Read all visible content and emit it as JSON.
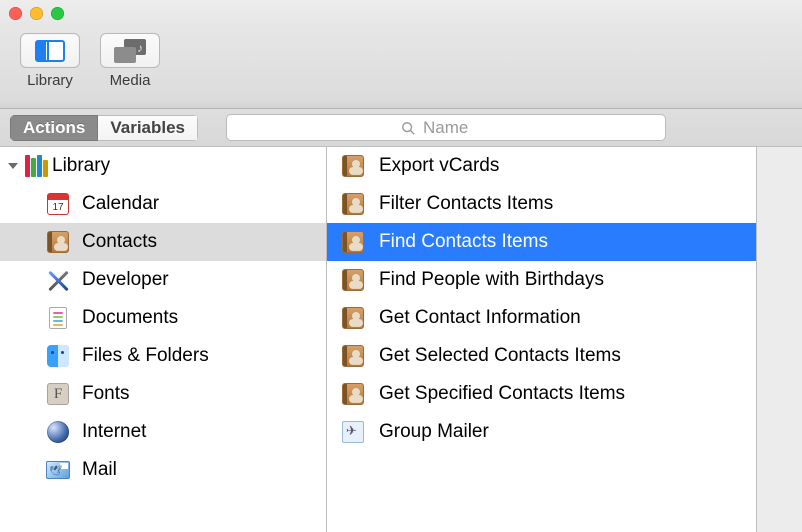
{
  "toolbar": {
    "library_label": "Library",
    "media_label": "Media"
  },
  "tabstrip": {
    "actions_label": "Actions",
    "variables_label": "Variables",
    "search_placeholder": "Name"
  },
  "tree": {
    "root_label": "Library",
    "items": [
      {
        "label": "Calendar",
        "icon": "calendar-icon"
      },
      {
        "label": "Contacts",
        "icon": "contacts-icon",
        "selected": true
      },
      {
        "label": "Developer",
        "icon": "developer-icon"
      },
      {
        "label": "Documents",
        "icon": "documents-icon"
      },
      {
        "label": "Files & Folders",
        "icon": "finder-icon"
      },
      {
        "label": "Fonts",
        "icon": "fonts-icon"
      },
      {
        "label": "Internet",
        "icon": "internet-icon"
      },
      {
        "label": "Mail",
        "icon": "mail-icon"
      }
    ]
  },
  "actions": {
    "items": [
      {
        "label": "Export vCards",
        "icon": "contacts-icon"
      },
      {
        "label": "Filter Contacts Items",
        "icon": "contacts-icon"
      },
      {
        "label": "Find Contacts Items",
        "icon": "contacts-icon",
        "selected": true
      },
      {
        "label": "Find People with Birthdays",
        "icon": "contacts-icon"
      },
      {
        "label": "Get Contact Information",
        "icon": "contacts-icon"
      },
      {
        "label": "Get Selected Contacts Items",
        "icon": "contacts-icon"
      },
      {
        "label": "Get Specified Contacts Items",
        "icon": "contacts-icon"
      },
      {
        "label": "Group Mailer",
        "icon": "mailer-icon"
      }
    ]
  }
}
